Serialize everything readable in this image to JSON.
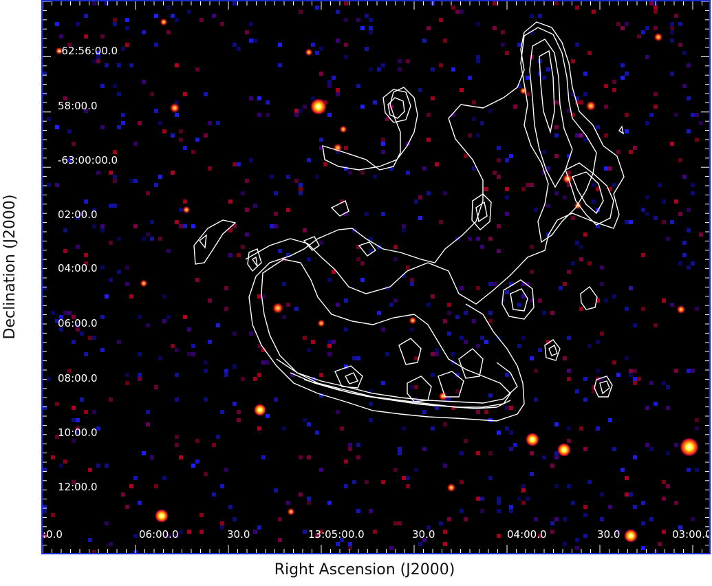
{
  "figure": {
    "ylabel": "Declination (J2000)",
    "xlabel": "Right Ascension (J2000)",
    "colors": {
      "frame": "#1a2bd6",
      "background": "#000000",
      "contour": "#ffffff"
    }
  },
  "axes": {
    "y_ticks": [
      "-62:56:00.0",
      "58:00.0",
      "-63:00:00.0",
      "02:00.0",
      "04:00.0",
      "06:00.0",
      "08:00.0",
      "10:00.0",
      "12:00.0"
    ],
    "x_ticks": [
      ":0.0",
      "06:00.0",
      "30.0",
      "13:05:00.0",
      "30.0",
      "04:00.0",
      "30.0",
      "03:00.0"
    ]
  }
}
